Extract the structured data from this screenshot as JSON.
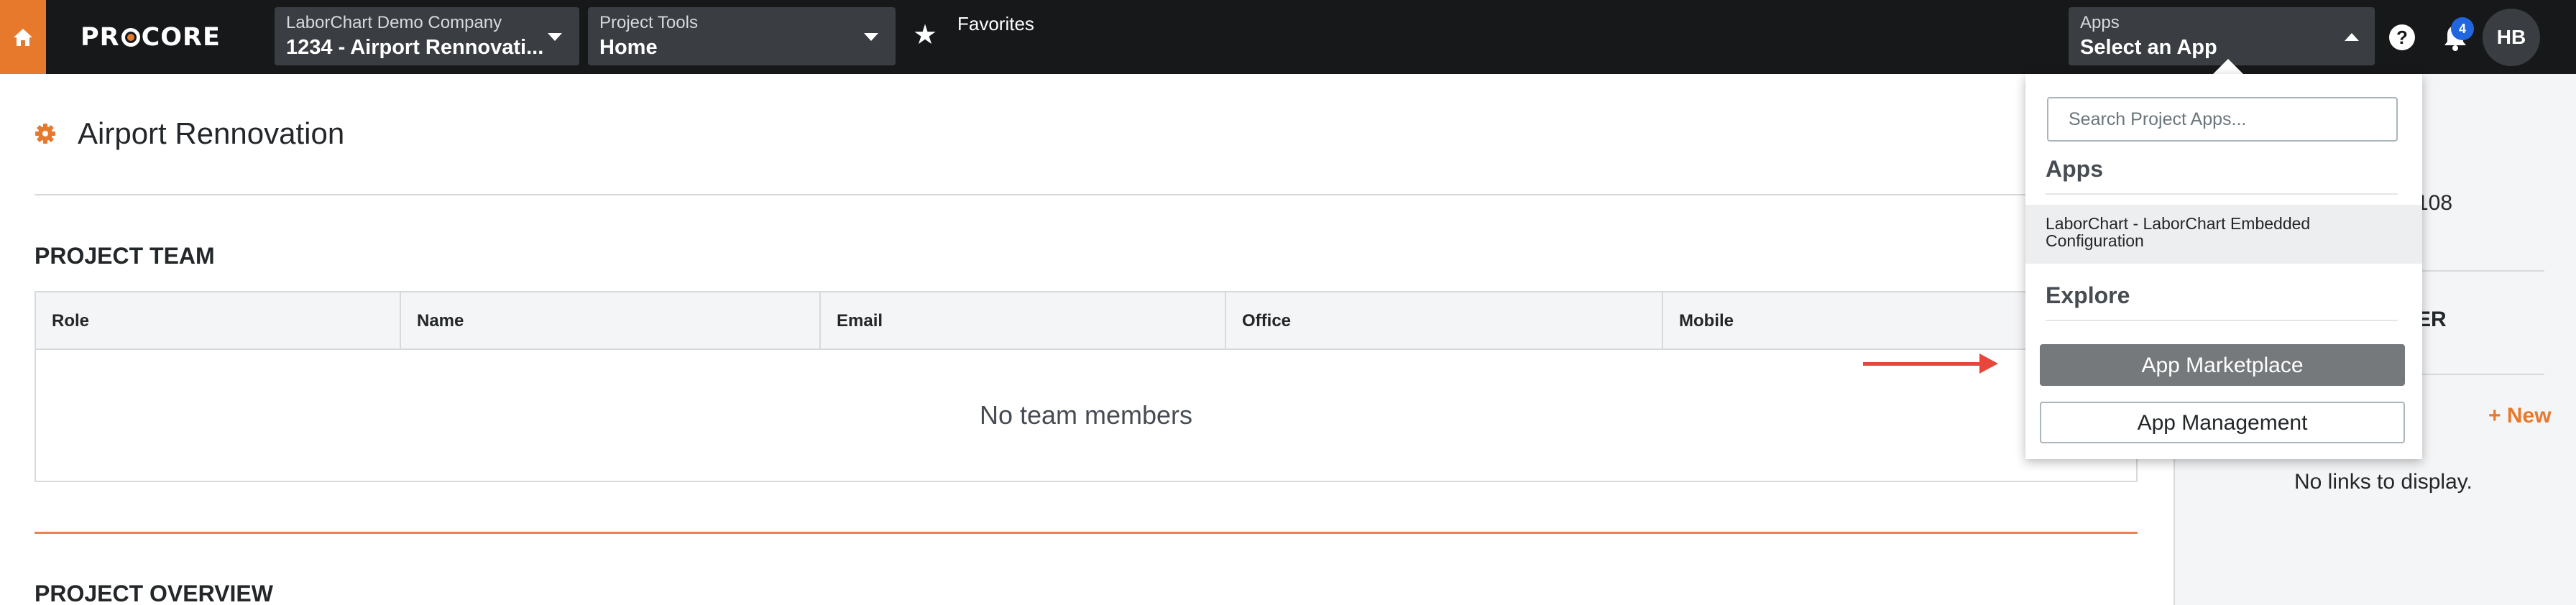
{
  "nav": {
    "company": {
      "label": "LaborChart Demo Company",
      "value": "1234 - Airport Rennovati..."
    },
    "tools": {
      "label": "Project Tools",
      "value": "Home"
    },
    "favorites_label": "Favorites",
    "apps": {
      "label": "Apps",
      "value": "Select an App"
    },
    "notification_count": "4",
    "avatar_initials": "HB",
    "help_glyph": "?",
    "accent_color": "#e7792d"
  },
  "page": {
    "title": "Airport Rennovation",
    "team_section_title": "PROJECT TEAM",
    "team_columns": [
      "Role",
      "Name",
      "Email",
      "Office",
      "Mobile"
    ],
    "team_empty_message": "No team members",
    "overview_section_title": "PROJECT OVERVIEW"
  },
  "right_panel": {
    "number_fragment": "108",
    "heading_fragment": "ER",
    "new_link": "+ New",
    "no_links": "No links to display."
  },
  "apps_dropdown": {
    "search_placeholder": "Search Project Apps...",
    "apps_heading": "Apps",
    "app_items": [
      "LaborChart - LaborChart Embedded Configuration"
    ],
    "explore_heading": "Explore",
    "marketplace_button": "App Marketplace",
    "management_button": "App Management"
  }
}
